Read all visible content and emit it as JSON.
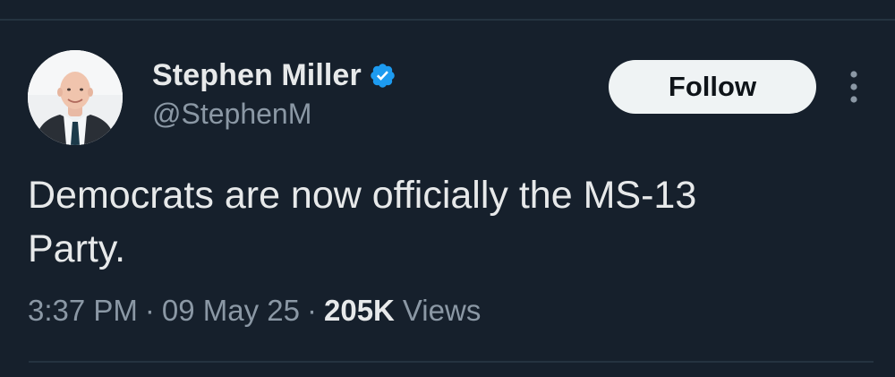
{
  "tweet": {
    "author": {
      "display_name": "Stephen Miller",
      "handle": "@StephenM",
      "verified": true,
      "verified_color": "#1d9bf0",
      "avatar_icon": "person-portrait-avatar"
    },
    "follow_label": "Follow",
    "more_icon": "vertical-ellipsis-icon",
    "text_lines": [
      "Democrats are now officially the MS-13",
      "Party."
    ],
    "time": "3:37 PM",
    "separator": "·",
    "date": "09 May 25",
    "views_count": "205K",
    "views_label": "Views"
  },
  "colors": {
    "background": "#16202c",
    "primary_text": "#e7e9ea",
    "secondary_text": "#8b98a5",
    "divider": "#253340",
    "follow_button_bg": "#eff3f4",
    "follow_button_text": "#0f1419"
  }
}
